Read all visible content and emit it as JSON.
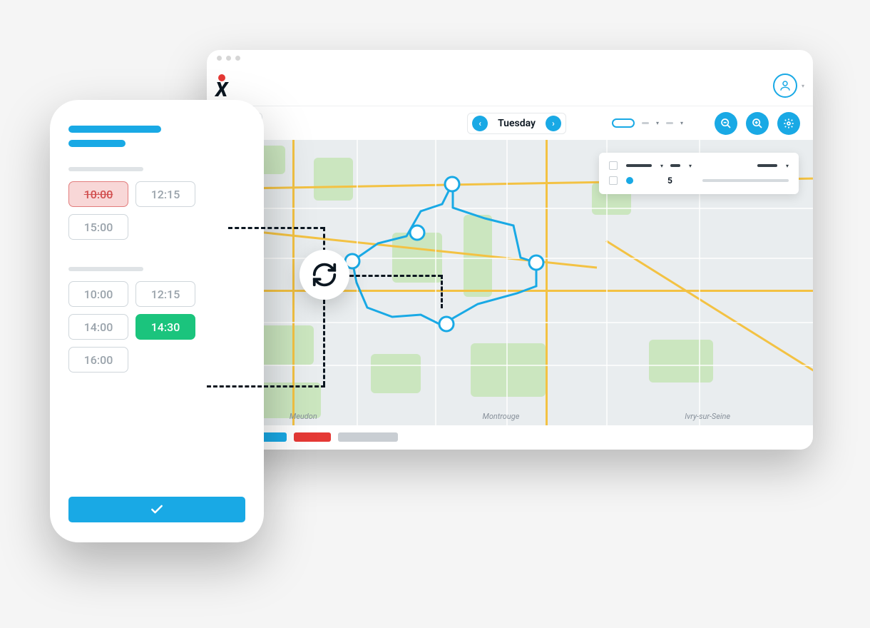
{
  "browser": {
    "day_label": "Tuesday",
    "legend": {
      "count": "5"
    },
    "map_labels": [
      "Meudon",
      "Montrouge",
      "Ivry-sur-Seine"
    ]
  },
  "phone": {
    "slots_before": {
      "removed": "10:00",
      "b": "12:15",
      "c": "15:00"
    },
    "slots_after": {
      "a": "10:00",
      "b": "12:15",
      "c": "14:00",
      "new": "14:30",
      "e": "16:00"
    }
  }
}
